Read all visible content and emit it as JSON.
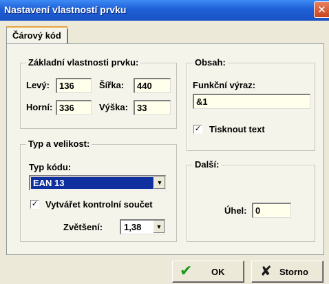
{
  "window": {
    "title": "Nastavení vlastností prvku",
    "close_glyph": "✕"
  },
  "tabs": [
    {
      "label": "Čárový kód",
      "active": true
    }
  ],
  "basic": {
    "legend": "Základní vlastnosti prvku:",
    "left_label": "Levý:",
    "left_value": "136",
    "width_label": "Šířka:",
    "width_value": "440",
    "top_label": "Horní:",
    "top_value": "336",
    "height_label": "Výška:",
    "height_value": "33"
  },
  "content": {
    "legend": "Obsah:",
    "expr_label": "Funkční výraz:",
    "expr_value": "&1",
    "print_text_label": "Tisknout text",
    "print_text_checked": true,
    "check_glyph": "✓"
  },
  "type_size": {
    "legend": "Typ a velikost:",
    "code_type_label": "Typ kódu:",
    "code_type_value": "EAN 13",
    "checksum_label": "Vytvářet kontrolní součet",
    "checksum_checked": true,
    "zoom_label": "Zvětšení:",
    "zoom_value": "1,38"
  },
  "other": {
    "legend": "Další:",
    "angle_label": "Úhel:",
    "angle_value": "0"
  },
  "buttons": {
    "ok_label": "OK",
    "ok_icon": "check-icon",
    "cancel_label": "Storno",
    "cancel_icon": "x-icon"
  },
  "colors": {
    "title_bar": "#1f5fd6",
    "selection": "#1030a0",
    "ok_icon": "#1a9a1a",
    "cancel_icon": "#1a1a1a"
  }
}
